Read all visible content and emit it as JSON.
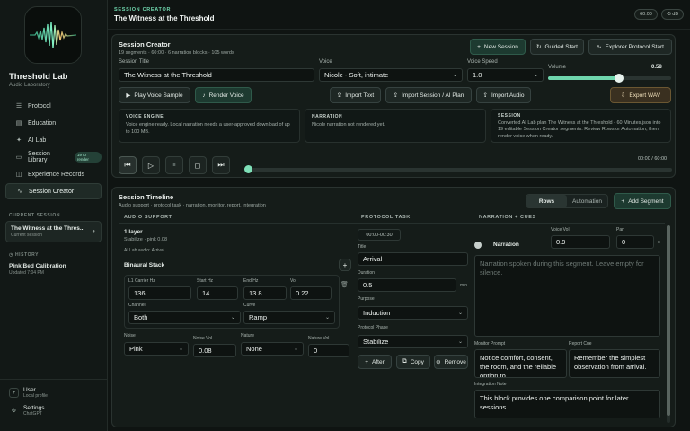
{
  "app": {
    "name": "Threshold Lab",
    "subtitle": "Audio Laboratory"
  },
  "nav": [
    {
      "label": "Protocol",
      "icon": "list-icon"
    },
    {
      "label": "Education",
      "icon": "book-icon"
    },
    {
      "label": "AI Lab",
      "icon": "sparkle-icon"
    },
    {
      "label": "Session Library",
      "icon": "folder-icon",
      "badge": "19 to render"
    },
    {
      "label": "Experience Records",
      "icon": "record-icon"
    },
    {
      "label": "Session Creator",
      "icon": "wave-icon"
    }
  ],
  "current_session": {
    "header": "CURRENT SESSION",
    "title": "The Witness at the Thres...",
    "sub": "Current session"
  },
  "history": {
    "header": "HISTORY",
    "items": [
      {
        "title": "Pink Bed Calibration",
        "sub": "Updated 7:04 PM"
      }
    ]
  },
  "footer": {
    "user": "User",
    "user_sub": "Local profile",
    "settings": "Settings",
    "settings_sub": "ChatGPT"
  },
  "topbar": {
    "kicker": "SESSION CREATOR",
    "title": "The Witness at the Threshold",
    "time": "60:00",
    "level": "-5 dB"
  },
  "creator": {
    "title": "Session Creator",
    "sub": "19 segments · 60:00 · 6 narration blocks · 105 words",
    "new_session": "New Session",
    "guided_start": "Guided Start",
    "explorer_start": "Explorer Protocol Start",
    "title_label": "Session Title",
    "title_value": "The Witness at the Threshold",
    "voice_label": "Voice",
    "voice_value": "Nicole - Soft, intimate",
    "speed_label": "Voice Speed",
    "speed_value": "1.0",
    "volume_label": "Volume",
    "volume_value": "0.58",
    "volume_fraction": 0.58,
    "play_sample": "Play Voice Sample",
    "render_voice": "Render Voice",
    "import_text": "Import Text",
    "import_session": "Import Session / AI Plan",
    "import_audio": "Import Audio",
    "export_wav": "Export WAV",
    "engine_h": "VOICE ENGINE",
    "engine_b": "Voice engine ready. Local narration needs a user-approved download of up to 100 MB.",
    "narr_h": "NARRATION",
    "narr_b": "Nicole narration not rendered yet.",
    "sess_h": "SESSION",
    "sess_b": "Converted AI Lab plan The Witness at the Threshold - 60 Minutes.json into 19 editable Session Creator segments. Review Rows or Automation, then render voice when ready.",
    "transport_time": "00:00 / 60:00"
  },
  "timeline": {
    "title": "Session Timeline",
    "sub": "Audio support · protocol task · narration, monitor, report, integration",
    "rows_tab": "Rows",
    "automation_tab": "Automation",
    "add_segment": "Add Segment",
    "col_audio": "AUDIO SUPPORT",
    "col_task": "PROTOCOL TASK",
    "col_narr": "NARRATION + CUES",
    "layer_title": "1 layer",
    "layer_sub": "Stabilize · pink 0.08",
    "layer_ai": "AI Lab audio: Arrival",
    "binaural": "Binaural Stack",
    "carrier_label": "L1 Carrier Hz",
    "carrier": "136",
    "start_label": "Start Hz",
    "start": "14",
    "end_label": "End Hz",
    "end": "13.8",
    "vol_label": "Vol",
    "vol": "0.22",
    "channel_label": "Channel",
    "channel": "Both",
    "curve_label": "Curve",
    "curve": "Ramp",
    "noise_label": "Noise",
    "noise": "Pink",
    "noise_vol_label": "Noise Vol",
    "noise_vol": "0.08",
    "nature_label": "Nature",
    "nature": "None",
    "nature_vol_label": "Nature Vol",
    "nature_vol": "0",
    "time_range": "00:00-00:30",
    "task_title_label": "Title",
    "task_title": "Arrival",
    "duration_label": "Duration",
    "duration": "0.5",
    "duration_unit": "min",
    "purpose_label": "Purpose",
    "purpose": "Induction",
    "phase_label": "Protocol Phase",
    "phase": "Stabilize",
    "after": "After",
    "copy": "Copy",
    "remove": "Remove",
    "narration_label": "Narration",
    "voice_vol_label": "Voice Vol",
    "voice_vol": "0.9",
    "pan_label": "Pan",
    "pan": "0",
    "pan_suffix": "c",
    "narr_placeholder": "Narration spoken during this segment. Leave empty for silence.",
    "monitor_label": "Monitor Prompt",
    "monitor": "Notice comfort, consent, the room, and the reliable option to",
    "report_label": "Report Cue",
    "report": "Remember the simplest observation from arrival.",
    "integration_label": "Integration Note",
    "integration": "This block provides one comparison point for later sessions."
  }
}
